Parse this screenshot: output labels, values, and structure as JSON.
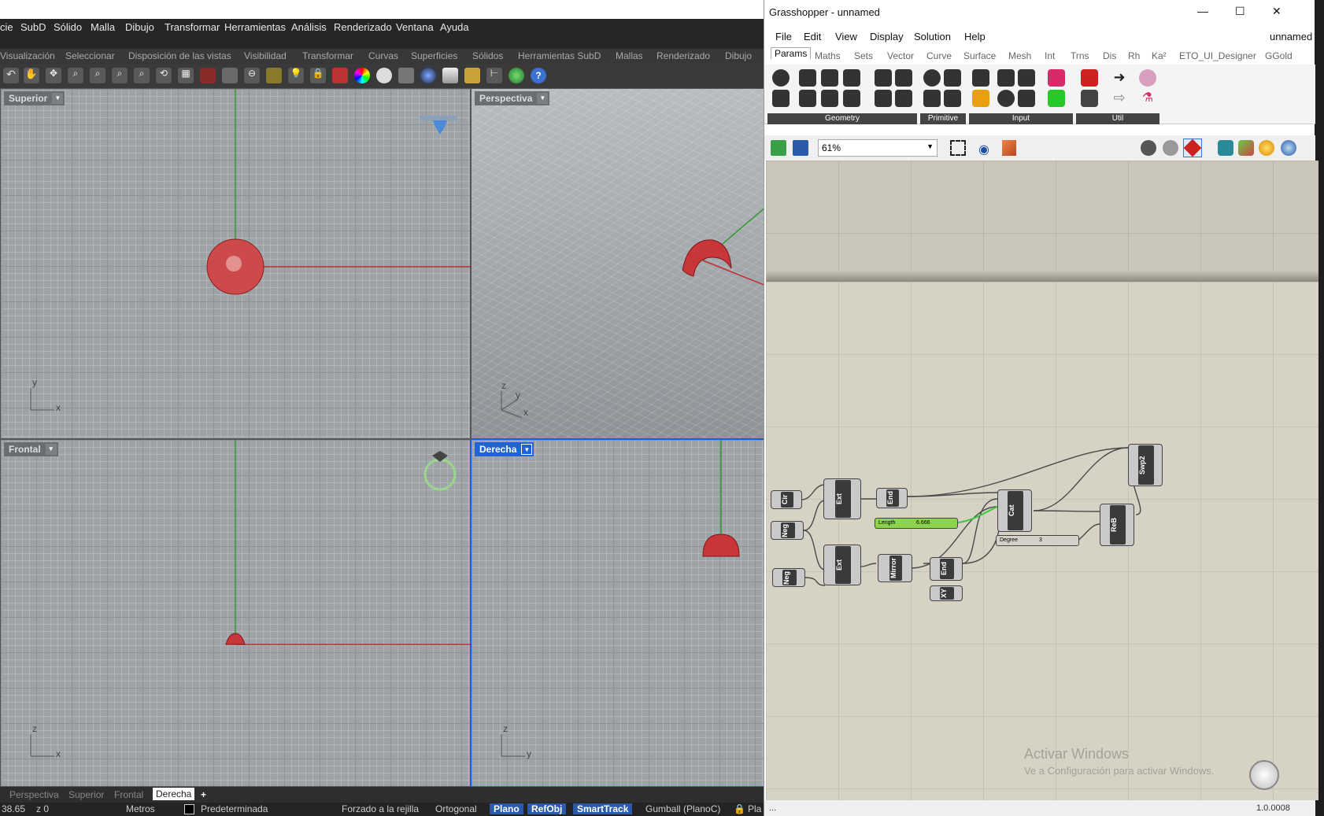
{
  "rhino": {
    "menu": [
      "cie",
      "SubD",
      "Sólido",
      "Malla",
      "Dibujo",
      "Transformar",
      "Herramientas",
      "Análisis",
      "Renderizado",
      "Ventana",
      "Ayuda"
    ],
    "command_tabs": [
      "Visualización",
      "Seleccionar",
      "Disposición de las vistas",
      "Visibilidad",
      "Transformar",
      "Curvas",
      "Superficies",
      "Sólidos",
      "Herramientas SubD",
      "Mallas",
      "Renderizado",
      "Dibujo"
    ],
    "viewports": {
      "top_left": {
        "label": "Superior",
        "axis1": "y",
        "axis2": "x"
      },
      "top_right": {
        "label": "Perspectiva",
        "axis1": "z",
        "axis2": "y",
        "axis3": "x"
      },
      "bottom_left": {
        "label": "Frontal",
        "axis1": "z",
        "axis2": "x"
      },
      "bottom_right": {
        "label": "Derecha",
        "axis1": "z",
        "axis2": "y"
      }
    },
    "view_tabs": [
      "Perspectiva",
      "Superior",
      "Frontal",
      "Derecha"
    ],
    "add_tab": "+",
    "status": {
      "coords": "38.65",
      "z": "z 0",
      "units": "Metros",
      "layer": "Predeterminada",
      "snap": "Forzado a la rejilla",
      "ortho": "Ortogonal",
      "planar": "Plano",
      "osnap": "RefObj",
      "smarttrack": "SmartTrack",
      "gumball": "Gumball (PlanoC)",
      "history": "Pla"
    },
    "colors": {
      "active_tab": "#1e64d8",
      "object": "#c8363a",
      "x_axis": "#c03030",
      "y_axis": "#2e9a2e"
    }
  },
  "grasshopper": {
    "title": "Grasshopper - unnamed",
    "window_controls": {
      "minimize": "—",
      "maximize": "☐",
      "close": "✕"
    },
    "menu": [
      "File",
      "Edit",
      "View",
      "Display",
      "Solution",
      "Help"
    ],
    "doc_name": "unnamed",
    "tabs": [
      "Params",
      "Maths",
      "Sets",
      "Vector",
      "Curve",
      "Surface",
      "Mesh",
      "Int",
      "Trns",
      "Dis",
      "Rh",
      "Ka²",
      "ETO_UI_Designer",
      "GGold"
    ],
    "ribbon_groups": [
      "Geometry",
      "Primitive",
      "Input",
      "Util"
    ],
    "zoom": "61%",
    "components": {
      "cir": "Cir",
      "neg1": "Neg",
      "neg2": "Neg",
      "ext1": "Ext",
      "ext2": "Ext",
      "end1": "End",
      "end2": "End",
      "mirror": "Mirror",
      "xy": "XY",
      "cat": "Cat",
      "reb": "ReB",
      "swp2": "Swp2"
    },
    "sliders": {
      "length": {
        "label": "Length",
        "value": "6.666"
      },
      "degree": {
        "label": "Degree",
        "value": "3"
      }
    },
    "watermark": {
      "line1": "Activar Windows",
      "line2": "Ve a Configuración para activar Windows."
    },
    "status_left": "...",
    "version": "1.0.0008"
  }
}
